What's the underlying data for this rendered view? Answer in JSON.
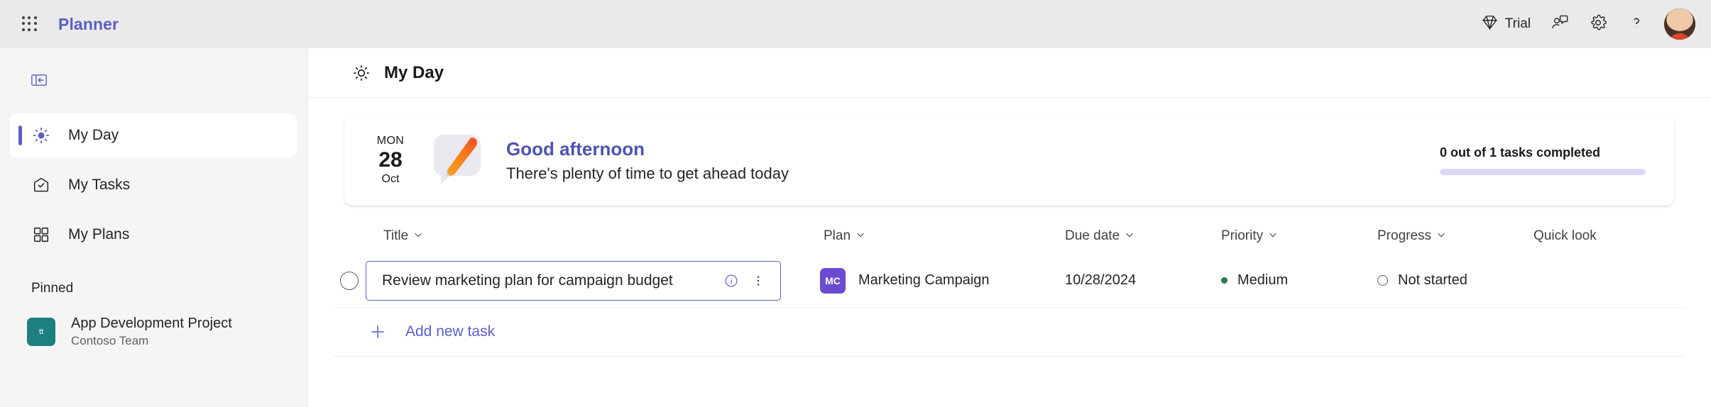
{
  "topbar": {
    "waffle_icon": "app-launcher-grid-icon",
    "brand": "Planner",
    "trial": {
      "icon": "diamond-icon",
      "label": "Trial"
    },
    "feedback_icon": "person-feedback-icon",
    "settings_icon": "gear-icon",
    "help_icon": "question-mark-icon",
    "avatar_icon": "user-avatar-photo"
  },
  "sidebar": {
    "collapse_icon": "collapse-panel-icon",
    "items": [
      {
        "label": "My Day",
        "icon": "sun-icon",
        "active": true
      },
      {
        "label": "My Tasks",
        "icon": "envelope-check-icon",
        "active": false
      },
      {
        "label": "My Plans",
        "icon": "grid-squares-icon",
        "active": false
      }
    ],
    "pinned_section_title": "Pinned",
    "pinned": [
      {
        "name": "App Development Project",
        "subtitle": "Contoso Team",
        "initials": "tt",
        "color": "#1d7f7f"
      }
    ]
  },
  "page": {
    "icon": "sun-icon",
    "title": "My Day"
  },
  "banner": {
    "day_of_week": "MON",
    "day_number": "28",
    "month": "Oct",
    "art_icon": "pencil-speech-bubble-illustration",
    "greeting": "Good afternoon",
    "subtitle": "There's plenty of time to get ahead today",
    "progress_label": "0 out of 1 tasks completed",
    "progress_percent": 0,
    "greeting_color": "#4f52b2",
    "progress_track_color": "#dcd9f7"
  },
  "table": {
    "columns": [
      {
        "label": "Title",
        "sortable": true
      },
      {
        "label": "Plan",
        "sortable": true
      },
      {
        "label": "Due date",
        "sortable": true
      },
      {
        "label": "Priority",
        "sortable": true
      },
      {
        "label": "Progress",
        "sortable": true
      },
      {
        "label": "Quick look",
        "sortable": false
      }
    ],
    "rows": [
      {
        "completed": false,
        "title": "Review marketing plan for campaign budget",
        "info_icon": "info-circle-icon",
        "more_icon": "more-vertical-icon",
        "plan_initials": "MC",
        "plan_color": "#6c4bd2",
        "plan": "Marketing Campaign",
        "due_date": "10/28/2024",
        "priority": "Medium",
        "priority_color": "#237b4b",
        "progress": "Not started",
        "quick_look": ""
      }
    ],
    "add_row": {
      "icon": "plus-icon",
      "label": "Add new task"
    }
  }
}
